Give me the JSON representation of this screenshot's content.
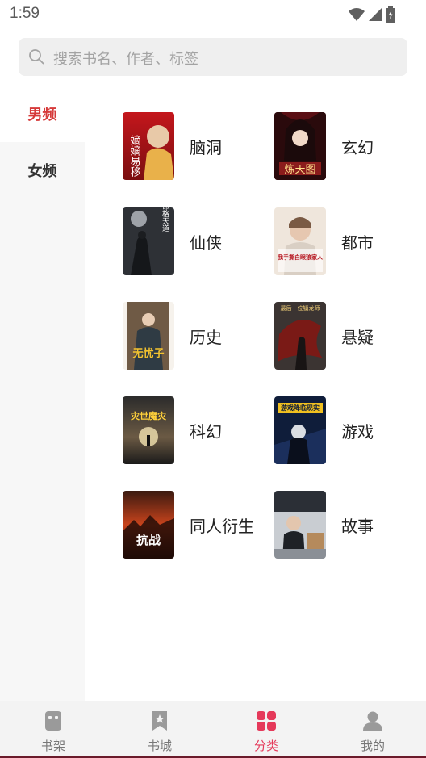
{
  "status_bar": {
    "time": "1:59"
  },
  "search": {
    "placeholder": "搜索书名、作者、标签"
  },
  "sidebar": {
    "tabs": [
      {
        "label": "男频",
        "active": true
      },
      {
        "label": "女频",
        "active": false
      }
    ]
  },
  "categories": [
    {
      "label": "脑洞",
      "cover_title": "嫡嫡易移"
    },
    {
      "label": "玄幻",
      "cover_title": "炼天图"
    },
    {
      "label": "仙侠",
      "cover_title": "命格天道"
    },
    {
      "label": "都市",
      "cover_title": "我手撕白眼狼家人"
    },
    {
      "label": "历史",
      "cover_title": "无忧子"
    },
    {
      "label": "悬疑",
      "cover_title": "最后一位镇龙师"
    },
    {
      "label": "科幻",
      "cover_title": "灾世魔灾"
    },
    {
      "label": "游戏",
      "cover_title": "游戏降临现实"
    },
    {
      "label": "同人衍生",
      "cover_title": "抗战"
    },
    {
      "label": "故事",
      "cover_title": ""
    }
  ],
  "bottom_nav": {
    "items": [
      {
        "label": "书架",
        "icon": "bookshelf-icon",
        "active": false
      },
      {
        "label": "书城",
        "icon": "bookstore-icon",
        "active": false
      },
      {
        "label": "分类",
        "icon": "category-grid-icon",
        "active": true
      },
      {
        "label": "我的",
        "icon": "profile-icon",
        "active": false
      }
    ]
  },
  "colors": {
    "accent": "#e5395a",
    "sidebar_active": "#d63a3a",
    "inactive_nav": "#9a9a9a"
  }
}
